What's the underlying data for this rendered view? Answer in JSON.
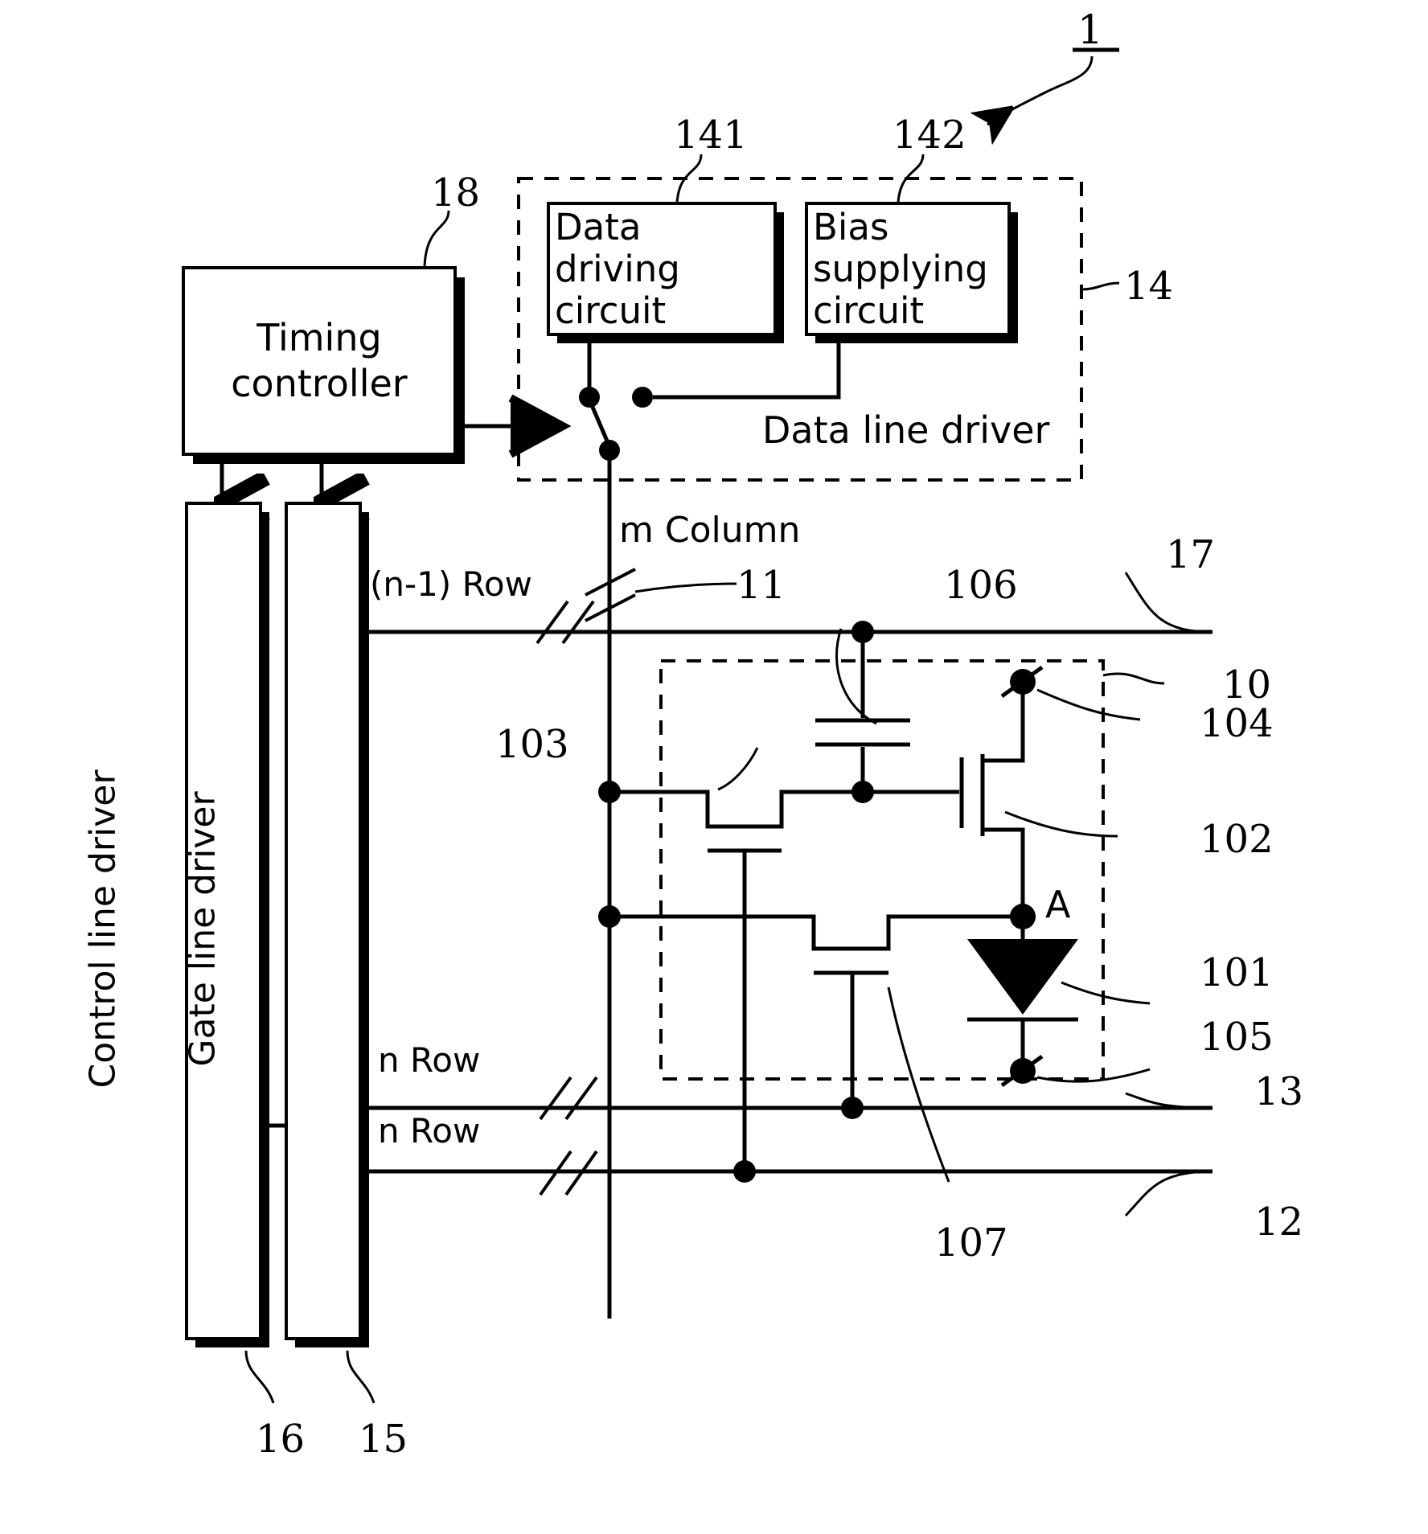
{
  "figure": {
    "main_ref": "1",
    "type": "patent-circuit-diagram",
    "description": "Display device block and pixel circuit schematic"
  },
  "blocks": {
    "timing_controller": {
      "label_line1": "Timing",
      "label_line2": "controller",
      "ref": "18"
    },
    "control_line_driver": {
      "label": "Control line driver",
      "ref": "16"
    },
    "gate_line_driver": {
      "label": "Gate line driver",
      "ref": "15"
    },
    "data_driving_circuit": {
      "label_line1": "Data",
      "label_line2": "driving",
      "label_line3": "circuit",
      "ref": "141"
    },
    "bias_supplying_circuit": {
      "label_line1": "Bias",
      "label_line2": "supplying",
      "label_line3": "circuit",
      "ref": "142"
    },
    "data_line_driver": {
      "label": "Data line driver",
      "ref": "14"
    },
    "pixel_circuit": {
      "ref": "10"
    }
  },
  "lines": {
    "m_column": "m Column",
    "n_minus_1_row": "(n-1) Row",
    "n_row_upper": "n Row",
    "n_row_lower": "n Row"
  },
  "refs": {
    "data_line_11": "11",
    "control_line_12": "12",
    "gate_line_13": "13",
    "power_line_17": "17",
    "pixel_10": "10",
    "terminal_104": "104",
    "drive_tft_102": "102",
    "oled_101": "101",
    "terminal_105": "105",
    "select_tft_103": "103",
    "storage_cap_106": "106",
    "cap_107": "107",
    "node_A": "A"
  },
  "colors": {
    "ink": "#000000",
    "paper": "#ffffff"
  }
}
